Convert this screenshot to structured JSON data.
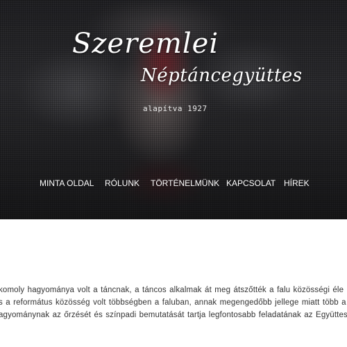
{
  "hero": {
    "title_line1": "Szeremlei",
    "title_line2": "Néptáncegyüttes",
    "subtitle": "alapítva 1927"
  },
  "nav": {
    "items": [
      {
        "label": "MINTA OLDAL"
      },
      {
        "label": "RÓLUNK"
      },
      {
        "label": "TÖRTÉNELMÜNK"
      },
      {
        "label": "KAPCSOLAT"
      },
      {
        "label": "HÍREK"
      }
    ]
  },
  "content": {
    "lines": [
      " komoly hagyománya volt a táncnak, a táncos alkalmak át meg átszőtték a falu közösségi éle",
      "s a református közösség volt többségben a faluban, annak megengedőbb jellege miatt több a",
      "agyománynak az őrzését és színpadi bemutatását tartja legfontosabb feladatának az Együttes. Jele"
    ]
  }
}
